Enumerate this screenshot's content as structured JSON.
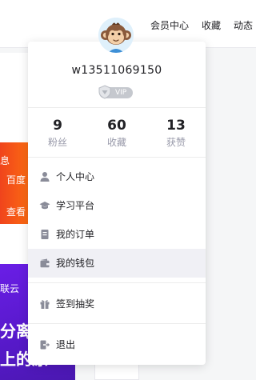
{
  "header": {
    "nav": [
      "会员中心",
      "收藏",
      "动态"
    ]
  },
  "background": {
    "orange_banner": [
      "息",
      "百度",
      "查看"
    ],
    "purple_banner": [
      "联云",
      "分离",
      "上的原"
    ]
  },
  "user_menu": {
    "username": "w13511069150",
    "vip_label": "VIP",
    "stats": [
      {
        "value": "9",
        "label": "粉丝"
      },
      {
        "value": "60",
        "label": "收藏"
      },
      {
        "value": "13",
        "label": "获赞"
      }
    ],
    "items": [
      {
        "label": "个人中心",
        "icon": "user-icon"
      },
      {
        "label": "学习平台",
        "icon": "graduation-cap-icon"
      },
      {
        "label": "我的订单",
        "icon": "order-icon"
      },
      {
        "label": "我的钱包",
        "icon": "wallet-icon",
        "active": true
      },
      {
        "label": "签到抽奖",
        "icon": "gift-icon"
      },
      {
        "label": "退出",
        "icon": "logout-icon"
      }
    ]
  },
  "colors": {
    "orange": "#f0441c",
    "purple": "#6a1ee6",
    "icon_gray": "#8a8c99",
    "active_bg": "#f0f0f5"
  }
}
